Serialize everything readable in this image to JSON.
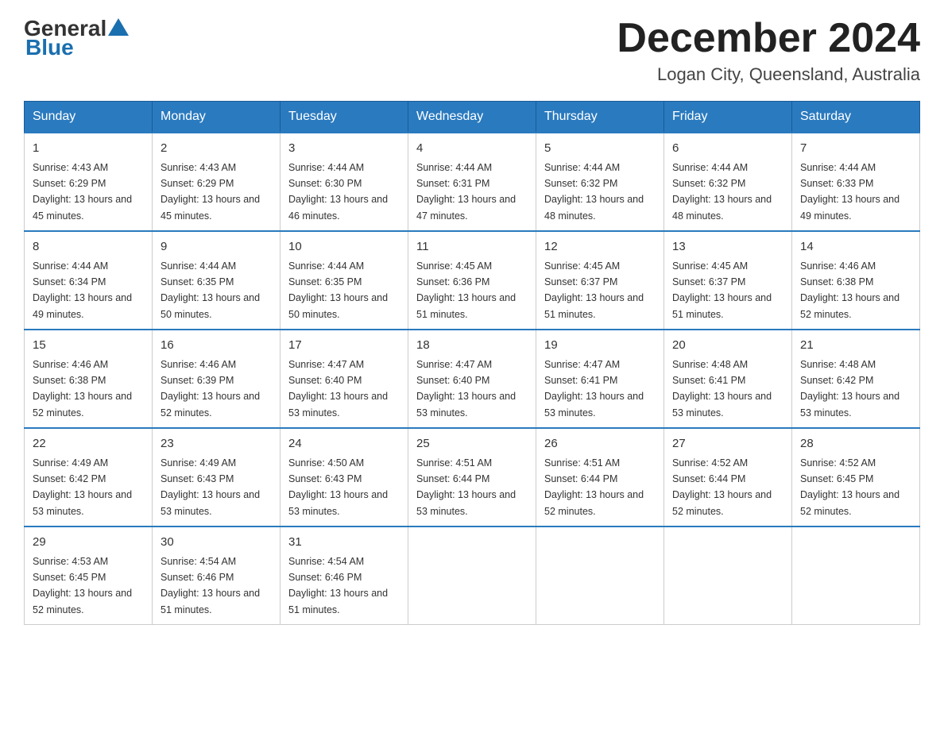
{
  "header": {
    "logo_general": "General",
    "logo_blue": "Blue",
    "title": "December 2024",
    "subtitle": "Logan City, Queensland, Australia"
  },
  "weekdays": [
    "Sunday",
    "Monday",
    "Tuesday",
    "Wednesday",
    "Thursday",
    "Friday",
    "Saturday"
  ],
  "weeks": [
    [
      {
        "day": "1",
        "sunrise": "4:43 AM",
        "sunset": "6:29 PM",
        "daylight": "13 hours and 45 minutes."
      },
      {
        "day": "2",
        "sunrise": "4:43 AM",
        "sunset": "6:29 PM",
        "daylight": "13 hours and 45 minutes."
      },
      {
        "day": "3",
        "sunrise": "4:44 AM",
        "sunset": "6:30 PM",
        "daylight": "13 hours and 46 minutes."
      },
      {
        "day": "4",
        "sunrise": "4:44 AM",
        "sunset": "6:31 PM",
        "daylight": "13 hours and 47 minutes."
      },
      {
        "day": "5",
        "sunrise": "4:44 AM",
        "sunset": "6:32 PM",
        "daylight": "13 hours and 48 minutes."
      },
      {
        "day": "6",
        "sunrise": "4:44 AM",
        "sunset": "6:32 PM",
        "daylight": "13 hours and 48 minutes."
      },
      {
        "day": "7",
        "sunrise": "4:44 AM",
        "sunset": "6:33 PM",
        "daylight": "13 hours and 49 minutes."
      }
    ],
    [
      {
        "day": "8",
        "sunrise": "4:44 AM",
        "sunset": "6:34 PM",
        "daylight": "13 hours and 49 minutes."
      },
      {
        "day": "9",
        "sunrise": "4:44 AM",
        "sunset": "6:35 PM",
        "daylight": "13 hours and 50 minutes."
      },
      {
        "day": "10",
        "sunrise": "4:44 AM",
        "sunset": "6:35 PM",
        "daylight": "13 hours and 50 minutes."
      },
      {
        "day": "11",
        "sunrise": "4:45 AM",
        "sunset": "6:36 PM",
        "daylight": "13 hours and 51 minutes."
      },
      {
        "day": "12",
        "sunrise": "4:45 AM",
        "sunset": "6:37 PM",
        "daylight": "13 hours and 51 minutes."
      },
      {
        "day": "13",
        "sunrise": "4:45 AM",
        "sunset": "6:37 PM",
        "daylight": "13 hours and 51 minutes."
      },
      {
        "day": "14",
        "sunrise": "4:46 AM",
        "sunset": "6:38 PM",
        "daylight": "13 hours and 52 minutes."
      }
    ],
    [
      {
        "day": "15",
        "sunrise": "4:46 AM",
        "sunset": "6:38 PM",
        "daylight": "13 hours and 52 minutes."
      },
      {
        "day": "16",
        "sunrise": "4:46 AM",
        "sunset": "6:39 PM",
        "daylight": "13 hours and 52 minutes."
      },
      {
        "day": "17",
        "sunrise": "4:47 AM",
        "sunset": "6:40 PM",
        "daylight": "13 hours and 53 minutes."
      },
      {
        "day": "18",
        "sunrise": "4:47 AM",
        "sunset": "6:40 PM",
        "daylight": "13 hours and 53 minutes."
      },
      {
        "day": "19",
        "sunrise": "4:47 AM",
        "sunset": "6:41 PM",
        "daylight": "13 hours and 53 minutes."
      },
      {
        "day": "20",
        "sunrise": "4:48 AM",
        "sunset": "6:41 PM",
        "daylight": "13 hours and 53 minutes."
      },
      {
        "day": "21",
        "sunrise": "4:48 AM",
        "sunset": "6:42 PM",
        "daylight": "13 hours and 53 minutes."
      }
    ],
    [
      {
        "day": "22",
        "sunrise": "4:49 AM",
        "sunset": "6:42 PM",
        "daylight": "13 hours and 53 minutes."
      },
      {
        "day": "23",
        "sunrise": "4:49 AM",
        "sunset": "6:43 PM",
        "daylight": "13 hours and 53 minutes."
      },
      {
        "day": "24",
        "sunrise": "4:50 AM",
        "sunset": "6:43 PM",
        "daylight": "13 hours and 53 minutes."
      },
      {
        "day": "25",
        "sunrise": "4:51 AM",
        "sunset": "6:44 PM",
        "daylight": "13 hours and 53 minutes."
      },
      {
        "day": "26",
        "sunrise": "4:51 AM",
        "sunset": "6:44 PM",
        "daylight": "13 hours and 52 minutes."
      },
      {
        "day": "27",
        "sunrise": "4:52 AM",
        "sunset": "6:44 PM",
        "daylight": "13 hours and 52 minutes."
      },
      {
        "day": "28",
        "sunrise": "4:52 AM",
        "sunset": "6:45 PM",
        "daylight": "13 hours and 52 minutes."
      }
    ],
    [
      {
        "day": "29",
        "sunrise": "4:53 AM",
        "sunset": "6:45 PM",
        "daylight": "13 hours and 52 minutes."
      },
      {
        "day": "30",
        "sunrise": "4:54 AM",
        "sunset": "6:46 PM",
        "daylight": "13 hours and 51 minutes."
      },
      {
        "day": "31",
        "sunrise": "4:54 AM",
        "sunset": "6:46 PM",
        "daylight": "13 hours and 51 minutes."
      },
      null,
      null,
      null,
      null
    ]
  ]
}
